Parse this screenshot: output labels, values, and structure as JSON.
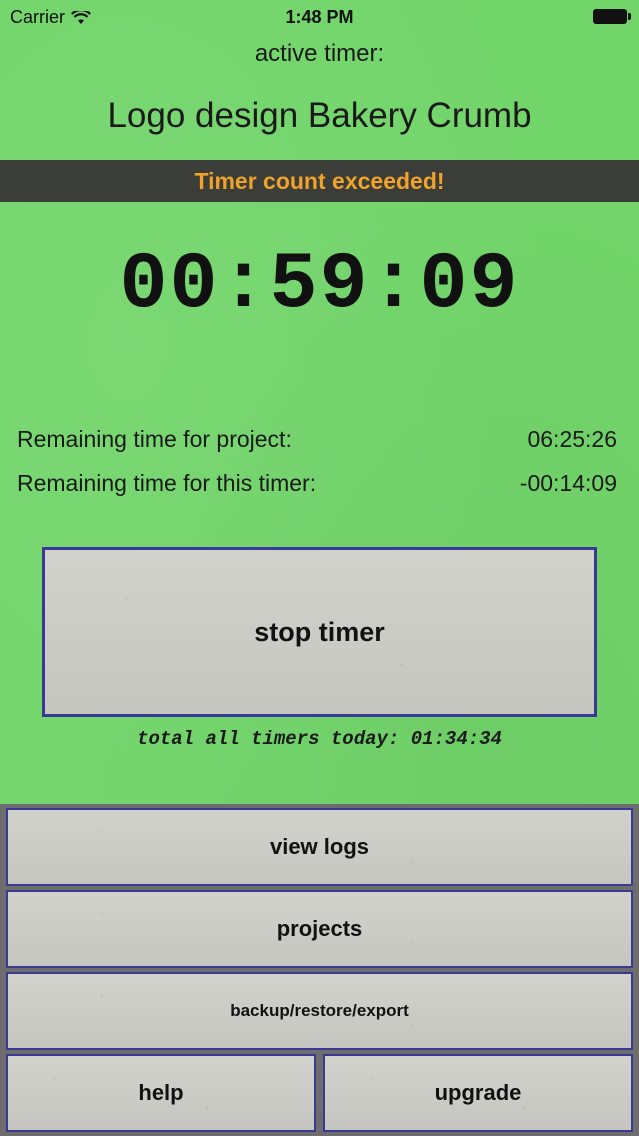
{
  "status_bar": {
    "carrier": "Carrier",
    "time": "1:48 PM"
  },
  "header": {
    "active_label": "active timer:",
    "timer_title": "Logo design Bakery Crumb"
  },
  "alert": {
    "text": "Timer count exceeded!",
    "color": "#f0a22a"
  },
  "clock": {
    "elapsed": "00:59:09"
  },
  "info": {
    "project_label": "Remaining time for project:",
    "project_value": "06:25:26",
    "timer_label": "Remaining time for this timer:",
    "timer_value": "-00:14:09"
  },
  "actions": {
    "stop_label": "stop timer",
    "total_line": "total all timers today: 01:34:34"
  },
  "menu": {
    "view_logs": "view logs",
    "projects": "projects",
    "backup": "backup/restore/export",
    "help": "help",
    "upgrade": "upgrade"
  },
  "colors": {
    "background": "#72d56a",
    "button_border": "#3b3a92",
    "alert_bar": "#3a3d38"
  }
}
